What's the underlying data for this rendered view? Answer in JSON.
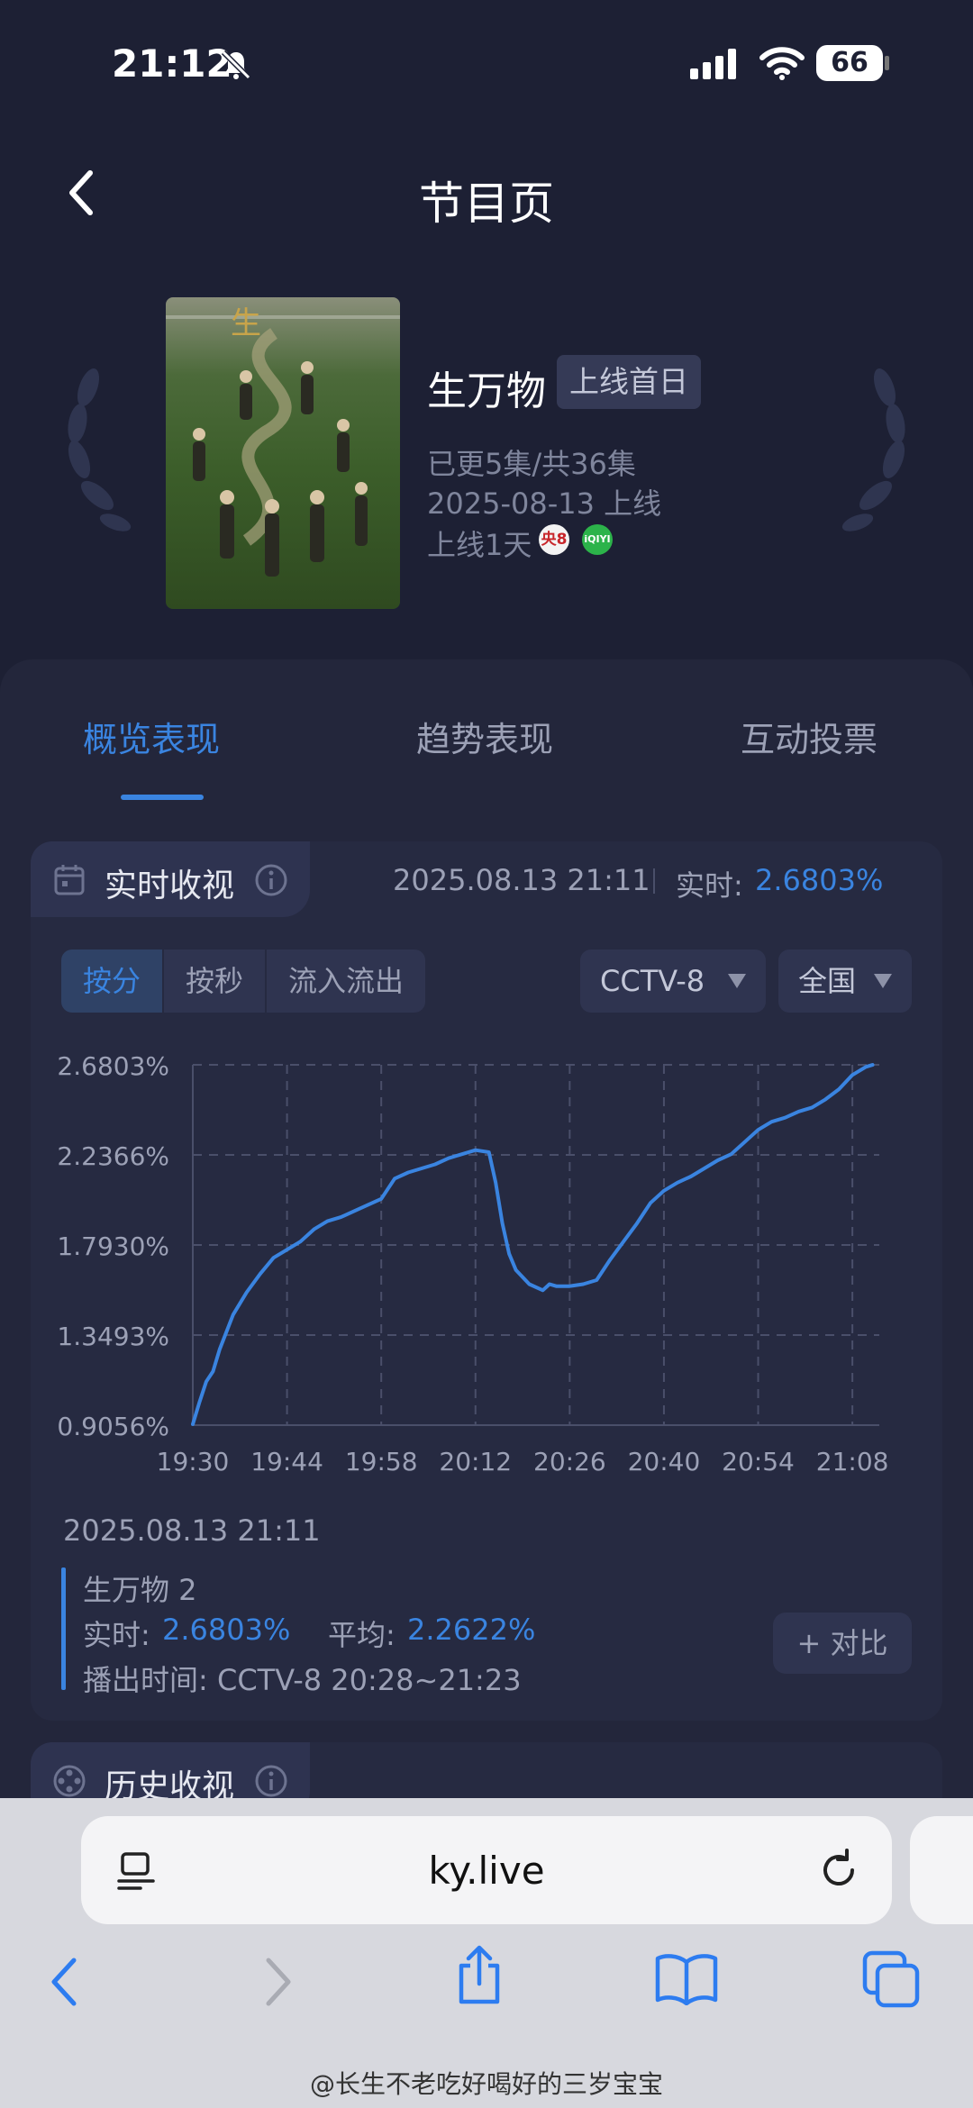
{
  "status_bar": {
    "time": "21:12",
    "battery": "66"
  },
  "header": {
    "title": "节目页"
  },
  "show": {
    "title": "生万物",
    "tag": "上线首日",
    "episodes": "已更5集/共36集",
    "release": "2025-08-13 上线",
    "days_online": "上线1天",
    "channel_badges": [
      "央8",
      "iQIYI"
    ]
  },
  "tabs": [
    {
      "label": "概览表现",
      "active": true
    },
    {
      "label": "趋势表现",
      "active": false
    },
    {
      "label": "互动投票",
      "active": false
    }
  ],
  "realtime": {
    "title": "实时收视",
    "timestamp": "2025.08.13 21:11",
    "rt_label": "实时:",
    "rt_value": "2.6803%",
    "segments": [
      "按分",
      "按秒",
      "流入流出"
    ],
    "active_segment": "按分",
    "channel": "CCTV-8",
    "region": "全国"
  },
  "chart_data": {
    "type": "line",
    "y_ticks": [
      "2.6803%",
      "2.2366%",
      "1.7930%",
      "1.3493%",
      "0.9056%"
    ],
    "x_ticks": [
      "19:30",
      "19:44",
      "19:58",
      "20:12",
      "20:26",
      "20:40",
      "20:54",
      "21:08"
    ],
    "ylim": [
      0.9056,
      2.6803
    ],
    "xlim": [
      "19:30",
      "21:12"
    ],
    "grid": true,
    "series": [
      {
        "color": "#3a84e0",
        "points": [
          [
            "19:30",
            0.91
          ],
          [
            "19:31",
            1.02
          ],
          [
            "19:32",
            1.12
          ],
          [
            "19:33",
            1.17
          ],
          [
            "19:34",
            1.28
          ],
          [
            "19:36",
            1.45
          ],
          [
            "19:38",
            1.56
          ],
          [
            "19:40",
            1.65
          ],
          [
            "19:42",
            1.73
          ],
          [
            "19:44",
            1.77
          ],
          [
            "19:46",
            1.81
          ],
          [
            "19:48",
            1.87
          ],
          [
            "19:50",
            1.91
          ],
          [
            "19:52",
            1.93
          ],
          [
            "19:54",
            1.96
          ],
          [
            "19:56",
            1.99
          ],
          [
            "19:58",
            2.02
          ],
          [
            "20:00",
            2.12
          ],
          [
            "20:02",
            2.15
          ],
          [
            "20:04",
            2.17
          ],
          [
            "20:06",
            2.19
          ],
          [
            "20:08",
            2.22
          ],
          [
            "20:10",
            2.24
          ],
          [
            "20:12",
            2.26
          ],
          [
            "20:14",
            2.25
          ],
          [
            "20:15",
            2.1
          ],
          [
            "20:16",
            1.9
          ],
          [
            "20:17",
            1.75
          ],
          [
            "20:18",
            1.67
          ],
          [
            "20:20",
            1.6
          ],
          [
            "20:22",
            1.57
          ],
          [
            "20:23",
            1.6
          ],
          [
            "20:24",
            1.59
          ],
          [
            "20:26",
            1.59
          ],
          [
            "20:28",
            1.6
          ],
          [
            "20:30",
            1.62
          ],
          [
            "20:32",
            1.72
          ],
          [
            "20:34",
            1.81
          ],
          [
            "20:36",
            1.9
          ],
          [
            "20:38",
            2.0
          ],
          [
            "20:40",
            2.06
          ],
          [
            "20:42",
            2.1
          ],
          [
            "20:44",
            2.13
          ],
          [
            "20:46",
            2.17
          ],
          [
            "20:48",
            2.21
          ],
          [
            "20:50",
            2.24
          ],
          [
            "20:52",
            2.3
          ],
          [
            "20:54",
            2.36
          ],
          [
            "20:56",
            2.4
          ],
          [
            "20:58",
            2.42
          ],
          [
            "21:00",
            2.45
          ],
          [
            "21:02",
            2.47
          ],
          [
            "21:04",
            2.51
          ],
          [
            "21:06",
            2.56
          ],
          [
            "21:08",
            2.63
          ],
          [
            "21:10",
            2.67
          ],
          [
            "21:11",
            2.68
          ]
        ]
      }
    ]
  },
  "detail": {
    "timestamp": "2025.08.13 21:11",
    "name": "生万物 2",
    "rt_label": "实时:",
    "rt_value": "2.6803%",
    "avg_label": "平均:",
    "avg_value": "2.2622%",
    "air_label": "播出时间:",
    "air_value": "CCTV-8 20:28~21:23",
    "compare_button": "+ 对比"
  },
  "history": {
    "title": "历史收视"
  },
  "browser": {
    "url": "ky.live"
  },
  "watermark": "@长生不老吃好喝好的三岁宝宝",
  "colors": {
    "accent": "#3a84e0",
    "background": "#1d2034",
    "card": "#262a41"
  }
}
